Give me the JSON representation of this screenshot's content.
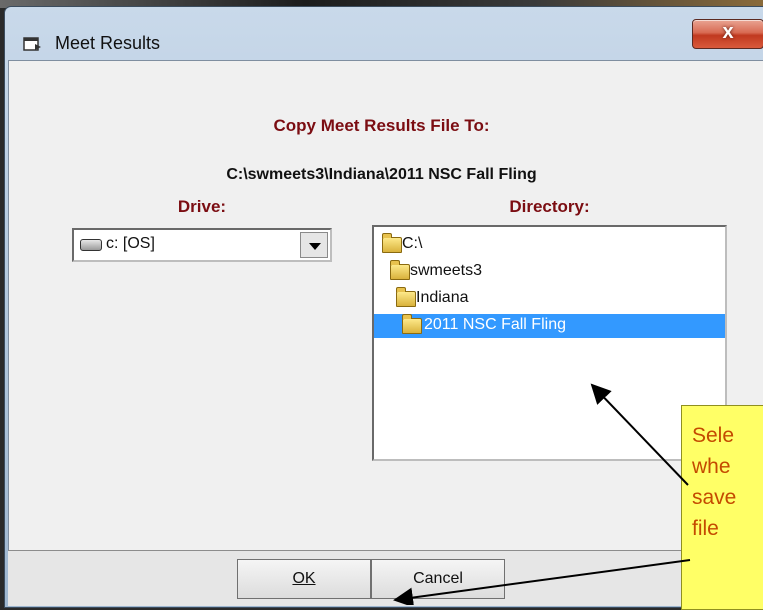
{
  "window": {
    "title": "Meet Results",
    "close_label": "x"
  },
  "dialog": {
    "heading": "Copy Meet Results File To:",
    "path": "C:\\swmeets3\\Indiana\\2011 NSC Fall Fling"
  },
  "drive": {
    "label": "Drive:",
    "selected": "c: [OS]",
    "icon": "drive-icon"
  },
  "directory": {
    "label": "Directory:",
    "items": [
      {
        "label": "C:\\",
        "icon": "folder-open-icon"
      },
      {
        "label": "swmeets3",
        "icon": "folder-open-icon"
      },
      {
        "label": "Indiana",
        "icon": "folder-open-icon"
      },
      {
        "label": "2011 NSC Fall Fling",
        "icon": "folder-open-icon",
        "selected": true
      }
    ]
  },
  "buttons": {
    "ok_label": "OK",
    "cancel_label": "Cancel"
  },
  "callout": {
    "lines": [
      "Sele",
      "whe",
      "save",
      "file"
    ],
    "background": "#ffff66",
    "text_color": "#c44a00"
  },
  "colors": {
    "label_red": "#7b0d12",
    "selection_blue": "#3399ff"
  }
}
